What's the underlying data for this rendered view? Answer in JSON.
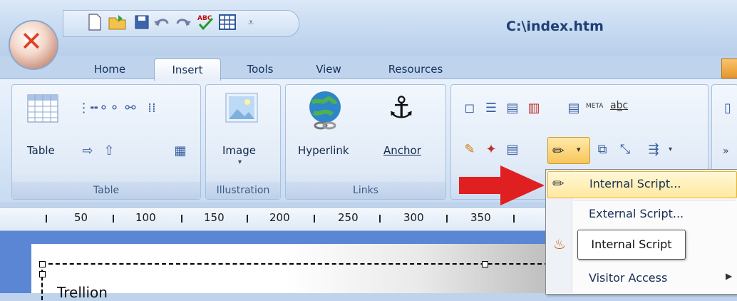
{
  "window": {
    "title": "C:\\index.htm"
  },
  "quick_access": {
    "icons": [
      "new-page-icon",
      "open-folder-icon",
      "save-icon",
      "undo-icon",
      "redo-icon",
      "spellcheck-icon",
      "table-grid-icon",
      "customize-chevron-icon"
    ]
  },
  "tabs": [
    "Home",
    "Insert",
    "Tools",
    "View",
    "Resources"
  ],
  "ribbon": {
    "table_group": {
      "label": "Table",
      "button": "Table"
    },
    "illustration_group": {
      "label": "Illustration",
      "button": "Image"
    },
    "links_group": {
      "label": "Links",
      "hyperlink": "Hyperlink",
      "anchor": "Anchor"
    }
  },
  "ruler": {
    "marks": [
      "50",
      "100",
      "150",
      "200",
      "250",
      "300",
      "350"
    ]
  },
  "menu": {
    "items": [
      "Internal Script...",
      "External Script...",
      "Visitor Access"
    ],
    "highlighted": "Internal Script..."
  },
  "tooltip": {
    "text": "Internal Script"
  },
  "document": {
    "text": "Trellion"
  },
  "colors": {
    "arrow": "#e02020",
    "canvas": "#5b86d4",
    "highlight": "#ffe9a0"
  }
}
